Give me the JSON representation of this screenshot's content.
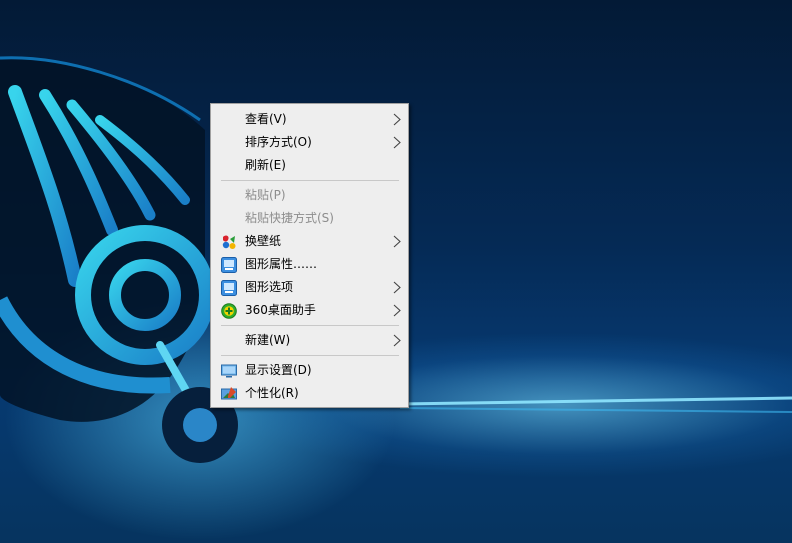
{
  "colors": {
    "menu_bg": "#eeeeee",
    "menu_border": "#a0a0a0",
    "text": "#000000",
    "disabled_text": "#8d8d8d",
    "desktop_bg": "#052a55",
    "glow": "#4fd8f4"
  },
  "context_menu": {
    "view": {
      "label": "查看(V)",
      "submenu": true
    },
    "sort": {
      "label": "排序方式(O)",
      "submenu": true
    },
    "refresh": {
      "label": "刷新(E)"
    },
    "paste": {
      "label": "粘贴(P)",
      "enabled": false
    },
    "paste_shortcut": {
      "label": "粘贴快捷方式(S)",
      "enabled": false
    },
    "wallpaper": {
      "label": "换壁纸",
      "icon": "wallpaper-app-icon",
      "submenu": true
    },
    "graphics_props": {
      "label": "图形属性……",
      "icon": "intel-graphics-icon"
    },
    "graphics_options": {
      "label": "图形选项",
      "icon": "intel-graphics-icon",
      "submenu": true
    },
    "desktop_helper": {
      "label": "360桌面助手",
      "icon": "360-helper-icon",
      "submenu": true
    },
    "new": {
      "label": "新建(W)",
      "submenu": true
    },
    "display_settings": {
      "label": "显示设置(D)",
      "icon": "monitor-icon"
    },
    "personalize": {
      "label": "个性化(R)",
      "icon": "personalize-icon"
    }
  }
}
